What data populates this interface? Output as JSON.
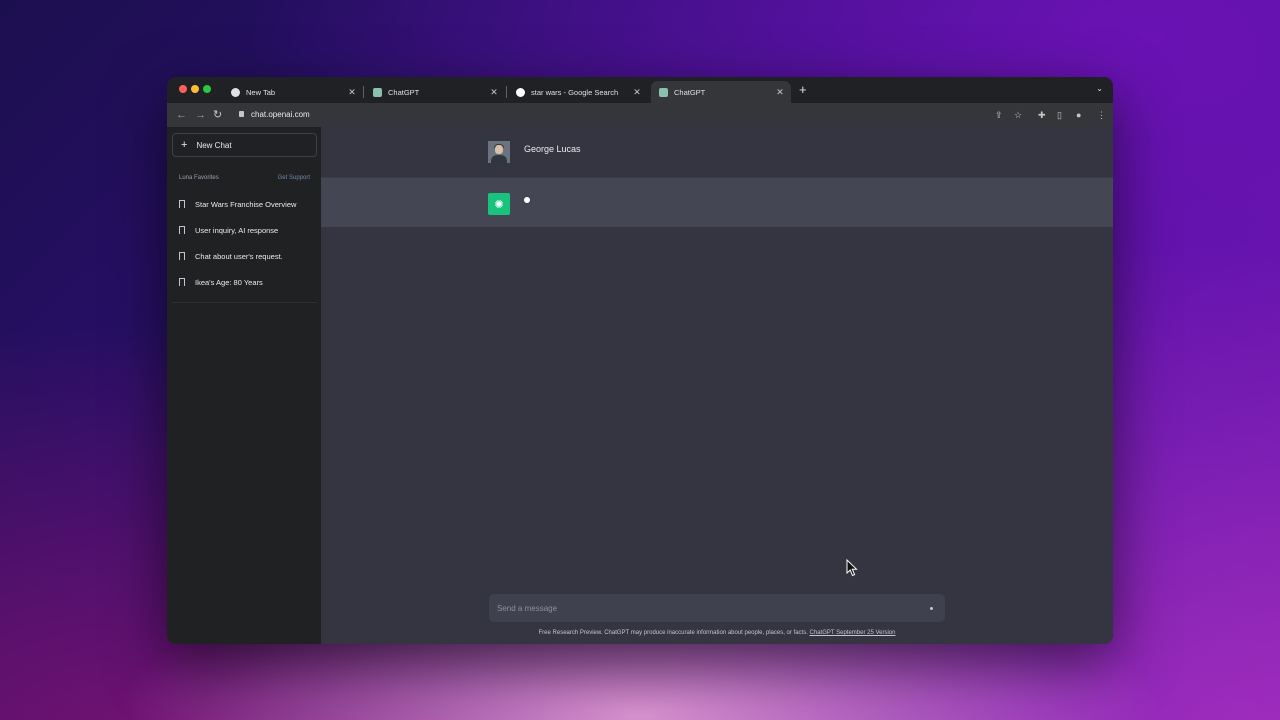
{
  "browser": {
    "tabs": [
      {
        "label": "New Tab",
        "favicon": "chrome-icon",
        "active": false
      },
      {
        "label": "ChatGPT",
        "favicon": "chatgpt-icon",
        "active": false
      },
      {
        "label": "star wars - Google Search",
        "favicon": "google-icon",
        "active": false
      },
      {
        "label": "ChatGPT",
        "favicon": "chatgpt-icon",
        "active": true
      }
    ],
    "url": "chat.openai.com"
  },
  "sidebar": {
    "new_chat_label": "New Chat",
    "section_label": "Luna Favorites",
    "support_link": "Get Support",
    "items": [
      {
        "label": "Star Wars Franchise Overview"
      },
      {
        "label": "User inquiry, AI response"
      },
      {
        "label": "Chat about user's request."
      },
      {
        "label": "Ikea's Age: 80 Years"
      }
    ]
  },
  "chat": {
    "user_name": "George Lucas",
    "input_placeholder": "Send a message",
    "footer_text": "Free Research Preview. ChatGPT may produce inaccurate information about people, places, or facts.",
    "footer_link": "ChatGPT September 25 Version"
  },
  "colors": {
    "page_bg": "#343541",
    "sidebar_bg": "#202123",
    "bot_row_bg": "#444654",
    "bot_avatar": "#19c37d"
  }
}
